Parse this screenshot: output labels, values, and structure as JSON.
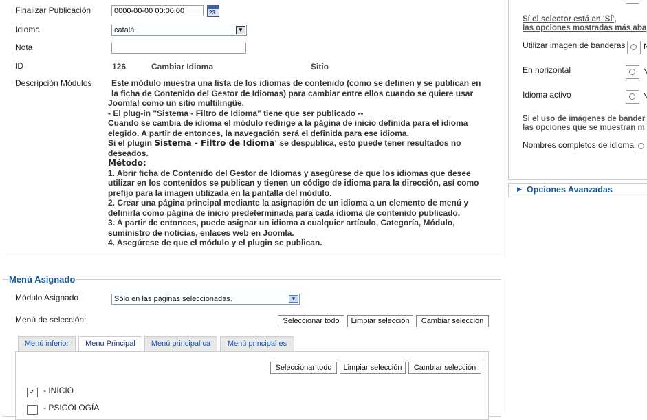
{
  "form": {
    "finalizar_label": "Finalizar Publicación",
    "finalizar_value": "0000-00-00 00:00:00",
    "idioma_label": "Idioma",
    "idioma_value": "català",
    "nota_label": "Nota",
    "nota_value": "",
    "id_label": "ID",
    "id_value": "126",
    "id_module": "Cambiar Idioma",
    "id_site": "Sitio",
    "desc_label": "Descripción Módulos",
    "desc_lines": [
      "Este módulo muestra una lista de los idiomas de contenido (como se definen y se publican en",
      "la ficha de Contenido del Gestor de Idiomas) para cambiar entre ellos cuando se quiere usar",
      "Joomla! como un sitio multilingüe.",
      "- El plug-in \"Sistema - Filtro de Idioma\" tiene que ser publicado --",
      "Cuando se cambia de idioma el módulo redirige a la página de inicio definida para el idioma",
      "elegido. A partir de entonces, la navegación será el definida para ese idioma.",
      "Si el plugin ",
      "Sistema - Filtro de Idioma'",
      " se despublica, esto puede tener resultados no",
      "deseados.",
      "Método:",
      "1. Abrir ficha de Contenido del Gestor de Idiomas y asegúrese de que los idiomas que desee",
      "utilizar en los contenidos se publican y tienen un código de idioma para la dirección, así como",
      "prefijo para la imagen utilizada en la pantalla del módulo.",
      "2. Crear una página principal mediante la asignación de un idioma a un elemento de menú y",
      "definirla como página de inicio predeterminada para cada idioma de contenido publicado.",
      "3. A partir de entonces, puede asignar un idioma a cualquier artículo, Categoría, Módulo,",
      "suministro de noticias, enlaces web en Joomla.",
      "4. Asegúrese de que el módulo y el plugin se publican."
    ]
  },
  "menu": {
    "legend": "Menú Asignado",
    "modulo_label": "Módulo Asignado",
    "modulo_value": "Sólo en las páginas seleccionadas.",
    "seleccion_label": "Menú de selección:",
    "select_all": "Seleccionar todo",
    "clear": "Limpiar selección",
    "toggle": "Cambiar selección",
    "tabs": [
      "Menú inferior",
      "Menu Principal",
      "Menú principal ca",
      "Menú principal es"
    ],
    "items": [
      "- INICIO",
      "- PSICOLOGÍA"
    ]
  },
  "options": {
    "note1_line1": "Sí el selector está en 'Sí',",
    "note1_line2": "las opciones mostradas más aba",
    "banderas_label": "Utilizar imagen de banderas",
    "horizontal_label": "En horizontal",
    "activo_label": "Idioma activo",
    "radio_letter": "N",
    "note2_line1": "Sí el uso de imágenes de bander",
    "note2_line2": "las opciones que se muestran m",
    "nombres_label": "Nombres completos de idioma",
    "advanced": "Opciones Avanzadas"
  },
  "colors": {
    "accent": "#0b55c4",
    "legend": "#1a5a9a",
    "border": "#cccccc"
  }
}
